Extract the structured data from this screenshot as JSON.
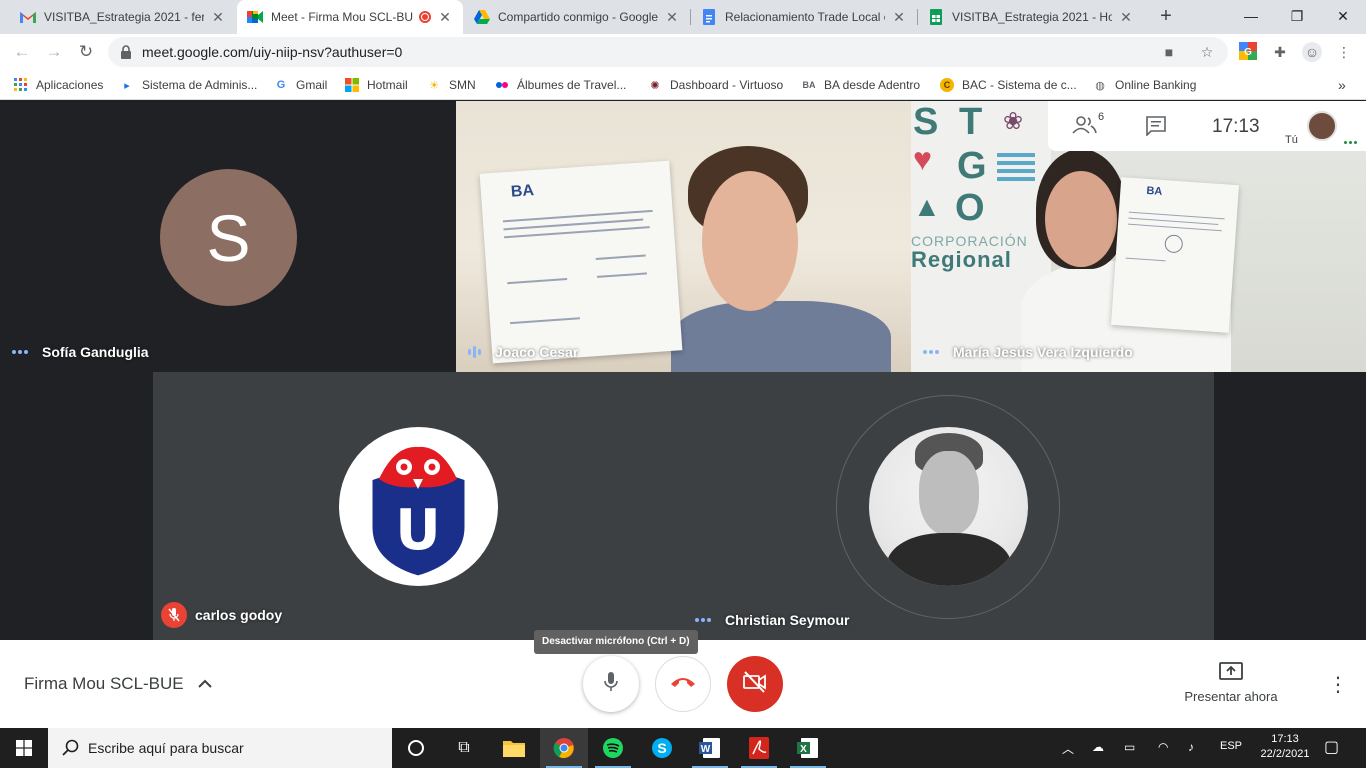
{
  "browser": {
    "tabs": [
      {
        "title": "VISITBA_Estrategia 2021 - ferna",
        "icon": "gmail-icon"
      },
      {
        "title": "Meet - Firma Mou SCL-BU",
        "icon": "meet-icon",
        "active": true,
        "recording": true
      },
      {
        "title": "Compartido conmigo - Google",
        "icon": "drive-icon"
      },
      {
        "title": "Relacionamiento Trade Local e",
        "icon": "docs-icon"
      },
      {
        "title": "VISITBA_Estrategia 2021 - Hoja",
        "icon": "sheets-icon"
      }
    ],
    "url": "meet.google.com/uiy-niip-nsv?authuser=0",
    "bookmarks": [
      {
        "label": "Aplicaciones",
        "icon": "apps-grid-icon"
      },
      {
        "label": "Sistema de Adminis...",
        "icon": "bookmark-site-icon"
      },
      {
        "label": "Gmail",
        "icon": "google-g-icon"
      },
      {
        "label": "Hotmail",
        "icon": "microsoft-icon"
      },
      {
        "label": "SMN",
        "icon": "weather-icon"
      },
      {
        "label": "Álbumes de Travel...",
        "icon": "flickr-icon"
      },
      {
        "label": "Dashboard - Virtuoso",
        "icon": "virtuoso-icon"
      },
      {
        "label": "BA desde Adentro",
        "icon": "ba-icon"
      },
      {
        "label": "BAC - Sistema de c...",
        "icon": "bac-icon"
      },
      {
        "label": "Online Banking",
        "icon": "globe-icon"
      }
    ],
    "bookmarks_overflow": "»"
  },
  "meet": {
    "participants_count": "6",
    "clock": "17:13",
    "self_label": "Tú",
    "participants": [
      {
        "name": "Sofía Ganduglia",
        "initial": "S",
        "avatar_color": "#8d6e63"
      },
      {
        "name": "Joaco Cesar"
      },
      {
        "name": "María Jesús Vera Izquierdo"
      },
      {
        "name": "carlos godoy",
        "muted": true
      },
      {
        "name": "Christian Seymour"
      }
    ],
    "sign_wall": {
      "letters": [
        "S",
        "T",
        "G",
        "O"
      ],
      "line1": "CORPORACIÓN",
      "line2": "Regional"
    },
    "document_logo": "BA",
    "team_logo_letter": "U",
    "meeting_title": "Firma Mou SCL-BUE",
    "tooltip": "Desactivar micrófono (Ctrl + D)",
    "present_label": "Presentar ahora",
    "colors": {
      "end_call": "#ea4335",
      "accent_dots": "#8ab4f8",
      "camera_off": "#d93025"
    }
  },
  "taskbar": {
    "search_placeholder": "Escribe aquí para buscar",
    "language": "ESP",
    "time": "17:13",
    "date": "22/2/2021"
  }
}
